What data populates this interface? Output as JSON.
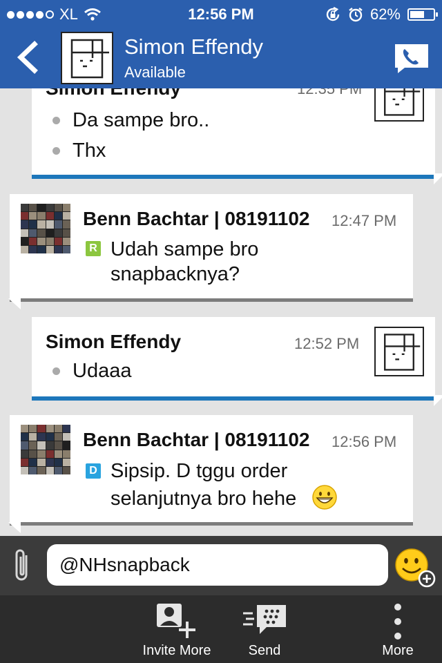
{
  "status_bar": {
    "carrier": "XL",
    "time": "12:56 PM",
    "battery_percent": "62%",
    "battery_level": 0.62,
    "signal_bars": 4,
    "icons": [
      "wifi-icon",
      "rotation-lock-icon",
      "alarm-icon",
      "battery-icon"
    ]
  },
  "header": {
    "contact_name": "Simon Effendy",
    "contact_status": "Available",
    "back_icon": "chevron-left-icon",
    "call_icon": "phone-icon",
    "accent": "#2b5fae"
  },
  "messages": [
    {
      "direction": "out",
      "sender": "Simon Effendy",
      "time": "12:35 PM",
      "lines": [
        "Da sampe bro..",
        "Thx"
      ]
    },
    {
      "direction": "in",
      "sender": "Benn Bachtar | 08191102",
      "time": "12:47 PM",
      "badge": "R",
      "text": [
        "Udah sampe bro",
        "snapbacknya?"
      ]
    },
    {
      "direction": "out",
      "sender": "Simon Effendy",
      "time": "12:52 PM",
      "lines": [
        "Udaaa"
      ]
    },
    {
      "direction": "in",
      "sender": "Benn Bachtar | 08191102",
      "time": "12:56 PM",
      "badge": "D",
      "text": [
        "Sipsip. D tggu order",
        "selanjutnya bro hehe"
      ],
      "emoji": "grinning-face-emoji"
    }
  ],
  "compose": {
    "value": "@NHsnapback",
    "attach_icon": "paperclip-icon",
    "emoji_icon": "smiley-add-icon"
  },
  "toolbar": {
    "invite_more": "Invite More",
    "send": "Send",
    "more": "More"
  },
  "colors": {
    "outgoing_bar": "#1d77bb",
    "read_badge": "#8cc63f",
    "delivered_badge": "#29a3df"
  }
}
